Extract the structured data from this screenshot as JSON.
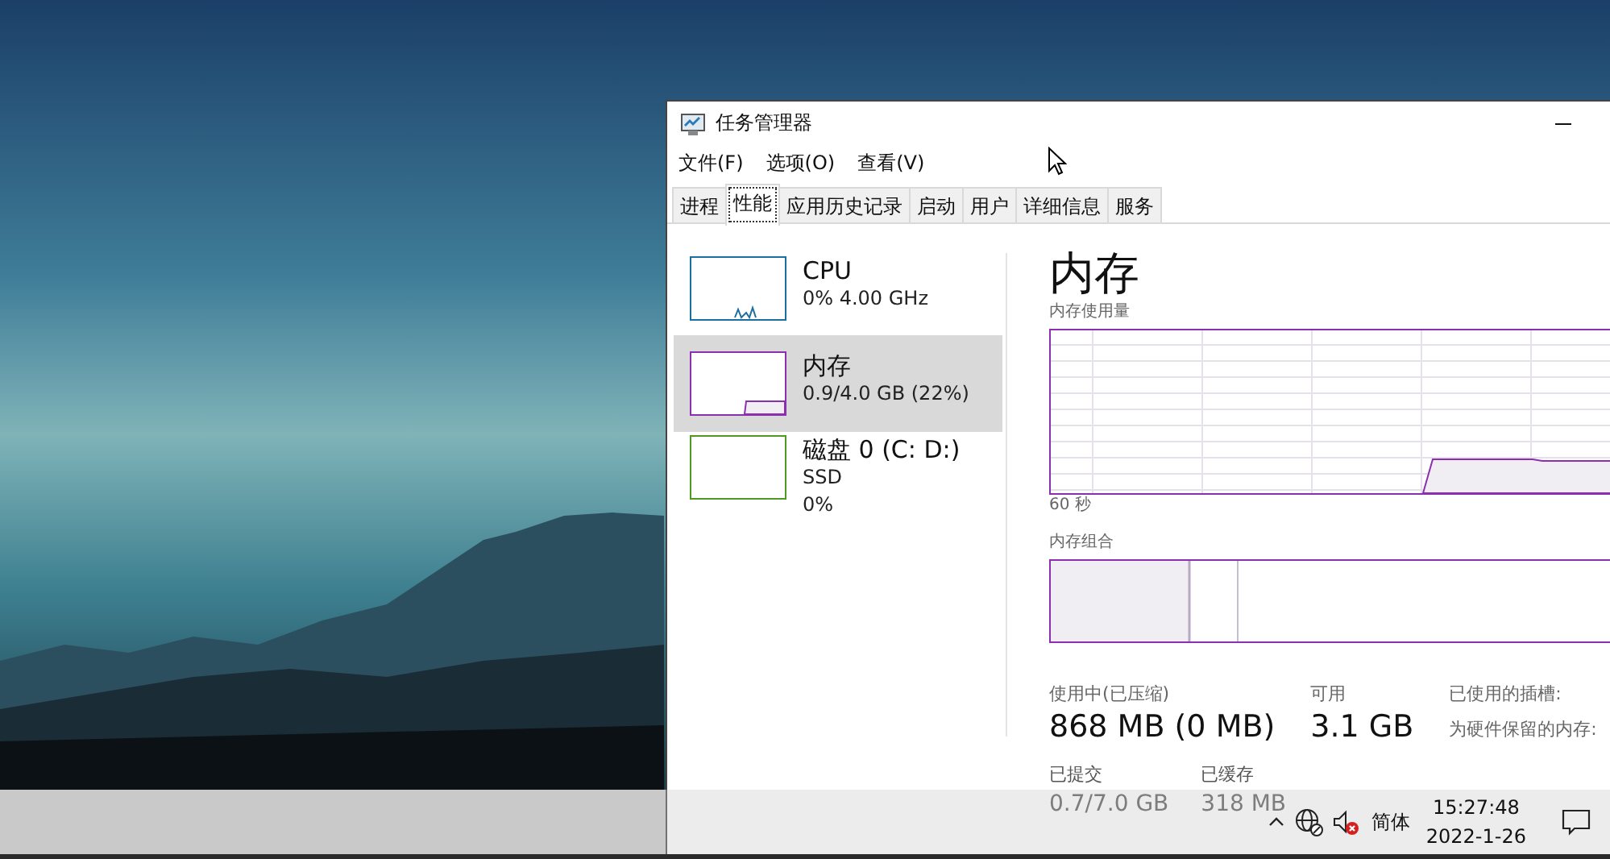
{
  "window": {
    "title": "任务管理器"
  },
  "menu": [
    "文件(F)",
    "选项(O)",
    "查看(V)"
  ],
  "tabs": [
    {
      "label": "进程",
      "selected": false
    },
    {
      "label": "性能",
      "selected": true
    },
    {
      "label": "应用历史记录",
      "selected": false
    },
    {
      "label": "启动",
      "selected": false
    },
    {
      "label": "用户",
      "selected": false
    },
    {
      "label": "详细信息",
      "selected": false
    },
    {
      "label": "服务",
      "selected": false
    }
  ],
  "resources": [
    {
      "kind": "cpu",
      "name": "CPU",
      "details": [
        "0% 4.00 GHz"
      ],
      "selected": false,
      "color": "#1b6fa0"
    },
    {
      "kind": "memory",
      "name": "内存",
      "details": [
        "0.9/4.0 GB (22%)"
      ],
      "selected": true,
      "color": "#8b2fb0"
    },
    {
      "kind": "disk",
      "name": "磁盘 0 (C: D:)",
      "details": [
        "SSD",
        "0%"
      ],
      "selected": false,
      "color": "#4d9a1f"
    }
  ],
  "detail": {
    "title": "内存",
    "usage_label": "内存使用量",
    "time_label": "60 秒",
    "composition_label": "内存组合",
    "stats": [
      {
        "label": "使用中(已压缩)",
        "value": "868 MB (0 MB)"
      },
      {
        "label": "可用",
        "value": "3.1 GB"
      }
    ],
    "side_labels": [
      "已使用的插槽:",
      "为硬件保留的内存:"
    ],
    "lower_stats": [
      {
        "label": "已提交",
        "value": "0.7/7.0 GB"
      },
      {
        "label": "已缓存",
        "value": "318 MB"
      }
    ]
  },
  "taskbar": {
    "input_method": "简体",
    "time": "15:27:48",
    "date": "2022-1-26"
  }
}
